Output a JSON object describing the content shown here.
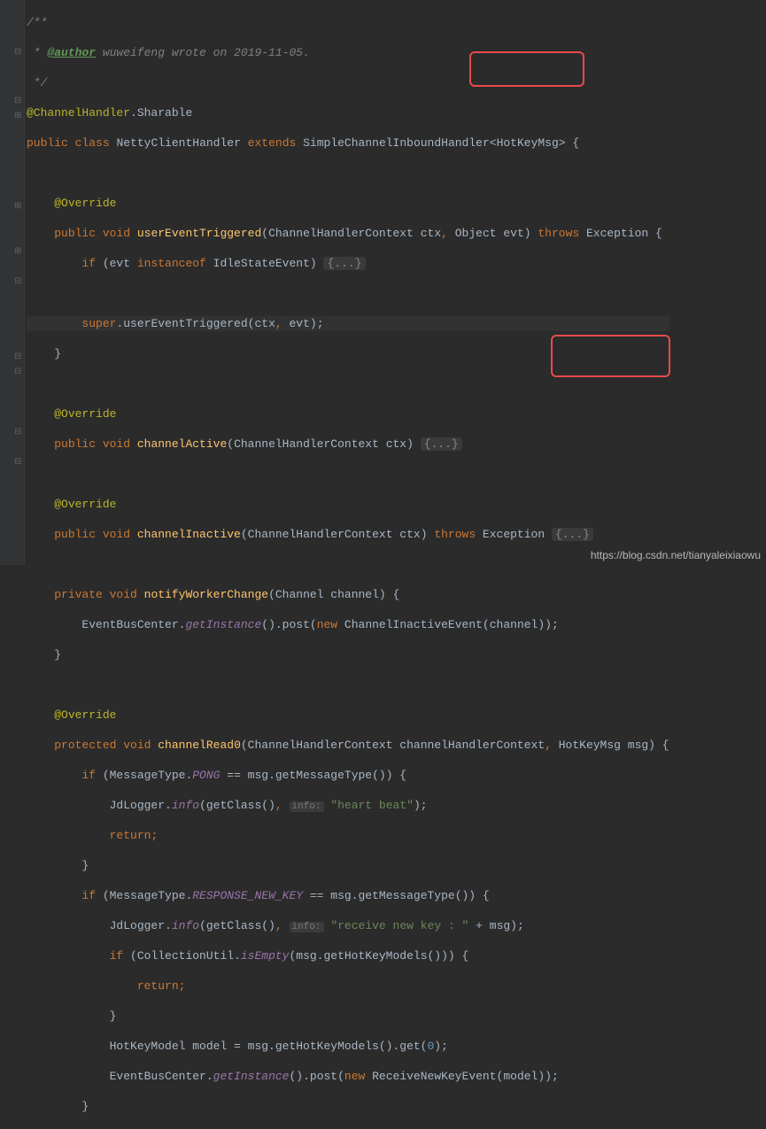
{
  "comment": {
    "l1": "/**",
    "l2_pre": " * ",
    "l2_tag": "@author",
    "l2_txt": " wuweifeng wrote on 2019-11-05.",
    "l3": " */"
  },
  "anno_sharable": "@ChannelHandler",
  "anno_sharable2": ".Sharable",
  "decl": {
    "public": "public",
    "class": "class",
    "name": "NettyClientHandler",
    "extends": "extends",
    "parent": "SimpleChannelInboundHandler",
    "generic_open": "<",
    "generic": "HotKeyMsg",
    "generic_close": ">",
    "brace": " {"
  },
  "override": "@Override",
  "uet": {
    "sig_pre": "public void ",
    "name": "userEventTriggered",
    "params": "(ChannelHandlerContext ctx",
    "comma": ", ",
    "p2": "Object evt) ",
    "throws": "throws",
    "exc": " Exception ",
    "brace": "{",
    "if": "if",
    "cond_pre": " (evt ",
    "inst": "instanceof",
    "cond_post": " IdleStateEvent) ",
    "fold": "{...}",
    "super": "super",
    "call": ".userEventTriggered(ctx",
    "comma2": ", ",
    "evt": "evt);",
    "close": "}"
  },
  "ca": {
    "sig_pre": "public void ",
    "name": "channelActive",
    "params": "(ChannelHandlerContext ctx) ",
    "fold": "{...}"
  },
  "ci": {
    "sig_pre": "public void ",
    "name": "channelInactive",
    "params": "(ChannelHandlerContext ctx) ",
    "throws": "throws",
    "exc": " Exception ",
    "fold": "{...}"
  },
  "nwc": {
    "private": "private void ",
    "name": "notifyWorkerChange",
    "params": "(Channel channel) {",
    "body1a": "EventBusCenter.",
    "body1b": "getInstance",
    "body1c": "().post(",
    "new": "new",
    "body1d": " ChannelInactiveEvent(channel));",
    "close": "}"
  },
  "cr0": {
    "sig_pre": "protected void ",
    "name": "channelRead0",
    "p1": "(ChannelHandlerContext channelHandlerContext",
    "comma": ", ",
    "p2": "HotKeyMsg msg) ",
    "brace": "{",
    "if": "if",
    "l2a": " (MessageType.",
    "pong": "PONG",
    "l2b": " == msg.getMessageType()) {",
    "l3a": "JdLogger.",
    "l3b": "info",
    "l3c": "(getClass()",
    "l3d": ", ",
    "hint1": "info:",
    "l3e": "\"heart beat\"",
    "l3f": ");",
    "ret": "return",
    "semi": ";",
    "close1": "}",
    "l6a": " (MessageType.",
    "rnk": "RESPONSE_NEW_KEY",
    "l6b": " == msg.getMessageType()) {",
    "l7a": "JdLogger.",
    "l7b": "info",
    "l7c": "(getClass()",
    "l7d": ", ",
    "hint2": "info:",
    "l7e": "\"receive new key : \"",
    "l7f": " + msg);",
    "l8a": " (CollectionUtil.",
    "l8b": "isEmpty",
    "l8c": "(msg.getHotKeyModels())) {",
    "close2": "}",
    "l10a": "HotKeyModel model = msg.getHotKeyModels().get(",
    "zero": "0",
    "l10b": ");",
    "l11a": "EventBusCenter.",
    "l11b": "getInstance",
    "l11c": "().post(",
    "l11d": " ReceiveNewKeyEvent(model));",
    "close3": "}"
  },
  "watermark": "https://blog.csdn.net/tianyaleixiaowu"
}
